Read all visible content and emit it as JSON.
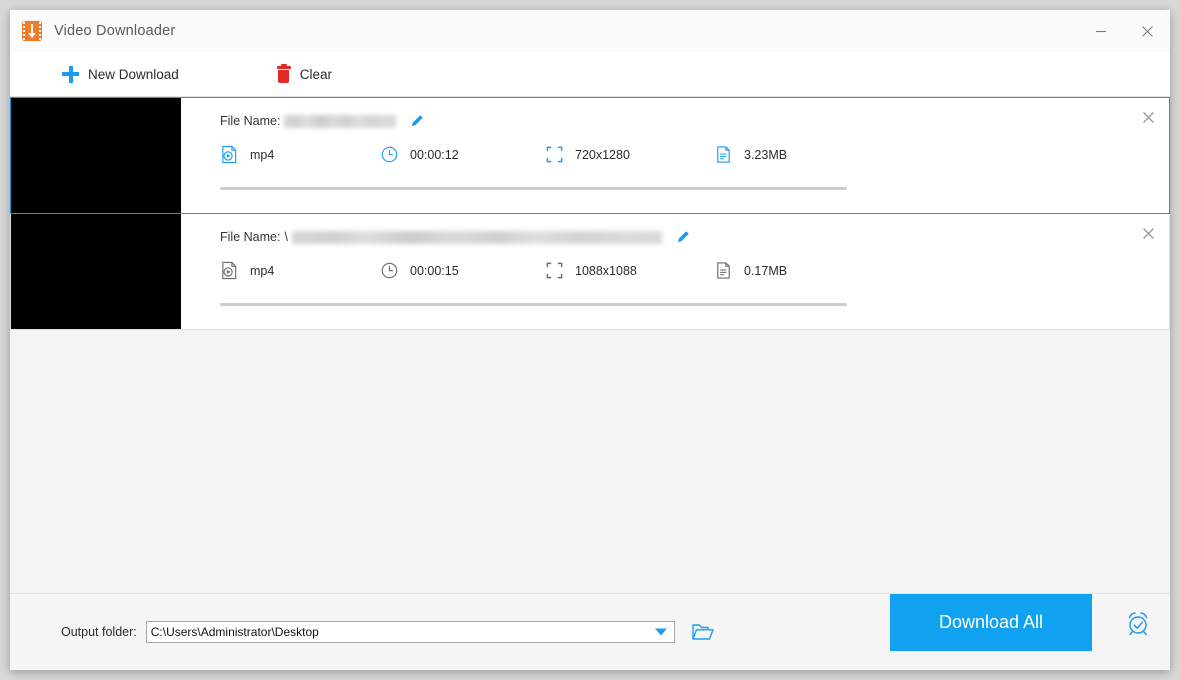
{
  "window": {
    "title": "Video Downloader",
    "app_icon": "video-download-icon",
    "controls": {
      "minimize": "minimize-icon",
      "close": "close-icon"
    }
  },
  "toolbar": {
    "new_download_label": "New Download",
    "new_download_icon": "plus-icon",
    "clear_label": "Clear",
    "clear_icon": "trash-icon"
  },
  "list": {
    "filename_label": "File Name:",
    "items": [
      {
        "selected": true,
        "filename_visible_prefix": "",
        "filename_redacted": true,
        "filename_blur_width": 112,
        "format": "mp4",
        "duration": "00:00:12",
        "resolution": "720x1280",
        "filesize": "3.23MB",
        "progress_percent": 0,
        "edit_icon": "pencil-icon",
        "close_icon": "close-icon",
        "icon_color": "#1e9bf0"
      },
      {
        "selected": false,
        "filename_visible_prefix": "\\",
        "filename_redacted": true,
        "filename_blur_width": 370,
        "format": "mp4",
        "duration": "00:00:15",
        "resolution": "1088x1088",
        "filesize": "0.17MB",
        "progress_percent": 0,
        "edit_icon": "pencil-icon",
        "close_icon": "close-icon",
        "icon_color": "#6b6b6b"
      }
    ]
  },
  "bottom": {
    "output_folder_label": "Output folder:",
    "output_folder_value": "C:\\Users\\Administrator\\Desktop",
    "browse_icon": "folder-open-icon",
    "download_all_label": "Download All",
    "schedule_icon": "alarm-clock-icon"
  },
  "colors": {
    "accent": "#10a2f0",
    "icon_blue": "#1e9bf0",
    "selected_border": "#2196d9",
    "brand_orange": "#f07b28",
    "danger_red": "#e02b25"
  }
}
